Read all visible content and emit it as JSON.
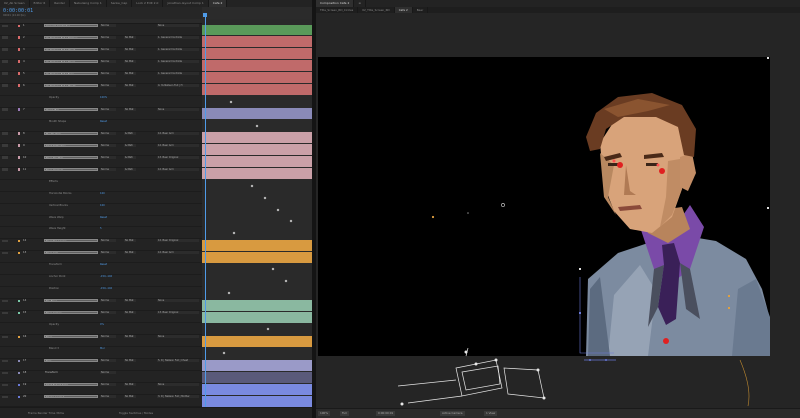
{
  "timeline": {
    "tabs": [
      {
        "label": "02_Ab Screen",
        "active": false
      },
      {
        "label": "Editor 6",
        "active": false
      },
      {
        "label": "Render",
        "active": false
      },
      {
        "label": "Nebulaing Comp 1",
        "active": false
      },
      {
        "label": "Sanke_Cap",
        "active": false
      },
      {
        "label": "Lock 2 Edit 2.0",
        "active": false
      },
      {
        "label": "Jonathan-layout Comp 1",
        "active": false
      },
      {
        "label": "Cafe 2",
        "active": true
      }
    ],
    "timecode": "0:00:00:01",
    "timecode_sub": "00001 (24.00 fps)",
    "accent": "#4f9be8",
    "layers": [
      {
        "num": "1",
        "name": "General Controller",
        "kind": "layer",
        "sel": true,
        "color": "#d86a6a",
        "mode": "Norma",
        "trk": "",
        "parent": "None",
        "bar": "#5a9a5a"
      },
      {
        "num": "2",
        "name": "Ya_Nalleon Full | Nalleon",
        "kind": "layer",
        "sel": true,
        "color": "#d86a6a",
        "mode": "Norma",
        "trk": "No Mat",
        "parent": "1. General Controlle",
        "bar": "#c06a6a"
      },
      {
        "num": "3",
        "name": "Ya_Nalleon Full | Chest",
        "kind": "layer",
        "sel": true,
        "color": "#d86a6a",
        "mode": "Norma",
        "trk": "No Mat",
        "parent": "1. General Controlle",
        "bar": "#c06a6a"
      },
      {
        "num": "4",
        "name": "Ya_Nalleon Full | Head",
        "kind": "layer",
        "sel": true,
        "color": "#d86a6a",
        "mode": "Norma",
        "trk": "No Mat",
        "parent": "1. General Controlle",
        "bar": "#c06a6a"
      },
      {
        "num": "5",
        "name": "Ya_Nalleon Full | Eyes",
        "kind": "layer",
        "sel": true,
        "color": "#d86a6a",
        "mode": "Norma",
        "trk": "No Mat",
        "parent": "1. General Controlle",
        "bar": "#c06a6a"
      },
      {
        "num": "6",
        "name": "Ya_Nalleon Full | Mouth",
        "kind": "layer",
        "sel": true,
        "color": "#d86a6a",
        "mode": "Norma",
        "trk": "No Mat",
        "parent": "4. Ya Nalleon Full | H",
        "bar": "#c06a6a"
      },
      {
        "num": "",
        "name": "Opacity",
        "kind": "prop",
        "val": "100%"
      },
      {
        "num": "7",
        "name": "Head (Bg)",
        "kind": "layer",
        "sel": true,
        "color": "#9a7ab8",
        "mode": "Norma",
        "trk": "No Mat",
        "parent": "None",
        "bar": "#8a8ab8"
      },
      {
        "num": "",
        "name": "Mouth Shape",
        "kind": "prop",
        "val": "Reset"
      },
      {
        "num": "8",
        "name": "Mouth_Plnk",
        "kind": "layer",
        "sel": true,
        "color": "#c89aa8",
        "mode": "Norma",
        "trk": "& Mati",
        "parent": "12. Beer Arm",
        "bar": "#caa0a8"
      },
      {
        "num": "9",
        "name": "Shirt Reflection",
        "kind": "layer",
        "sel": true,
        "color": "#c89aa8",
        "mode": "Norma",
        "trk": "& Mati",
        "parent": "12. Beer Arm",
        "bar": "#caa0a8"
      },
      {
        "num": "10",
        "name": "Beer Shelfish",
        "kind": "layer",
        "sel": true,
        "color": "#c89aa8",
        "mode": "Norma",
        "trk": "& Mati",
        "parent": "13. Beer Original",
        "bar": "#caa0a8"
      },
      {
        "num": "11",
        "name": "Beer Original",
        "kind": "layer",
        "sel": true,
        "color": "#c89aa8",
        "mode": "Norma",
        "trk": "& Mati",
        "parent": "12. Beer Arm",
        "bar": "#caa0a8"
      },
      {
        "num": "",
        "name": "Effects",
        "kind": "prop",
        "val": ""
      },
      {
        "num": "",
        "name": "Horizontal Blocks",
        "kind": "prop",
        "val": "100"
      },
      {
        "num": "",
        "name": "Vertical Blocks",
        "kind": "prop",
        "val": "100"
      },
      {
        "num": "",
        "name": "Wave Warp",
        "kind": "prop",
        "val": "Reset"
      },
      {
        "num": "",
        "name": "Wave Height",
        "kind": "prop",
        "val": "5"
      },
      {
        "num": "12",
        "name": "Beer Top Layers",
        "kind": "layer",
        "sel": true,
        "color": "#e0a040",
        "mode": "Norma",
        "trk": "No Mat",
        "parent": "12. Beer Original",
        "bar": "#d89a40"
      },
      {
        "num": "13",
        "name": "Beer Arm",
        "kind": "layer",
        "sel": true,
        "color": "#e0a040",
        "mode": "Norma",
        "trk": "No Mat",
        "parent": "12. Beer Arm",
        "bar": "#d89a40"
      },
      {
        "num": "",
        "name": "Transform",
        "kind": "prop",
        "val": "Reset"
      },
      {
        "num": "",
        "name": "Anchor Point",
        "kind": "prop",
        "val": "-150,-102"
      },
      {
        "num": "",
        "name": "Position",
        "kind": "prop",
        "val": "-150,-102"
      },
      {
        "num": "14",
        "name": "Bg_Beer",
        "kind": "layer",
        "sel": true,
        "color": "#7ac8a8",
        "mode": "Norma",
        "trk": "No Mat",
        "parent": "None",
        "bar": "#8ab8a0"
      },
      {
        "num": "15",
        "name": "Beer 2 Glow",
        "kind": "layer",
        "sel": true,
        "color": "#7ac8a8",
        "mode": "Norma",
        "trk": "No Mat",
        "parent": "13. Beer Original",
        "bar": "#8ab8a0"
      },
      {
        "num": "",
        "name": "Opacity",
        "kind": "prop",
        "val": "0%"
      },
      {
        "num": "16",
        "name": "Beer",
        "kind": "layer",
        "sel": true,
        "color": "#e0a040",
        "mode": "Norma",
        "trk": "No Mat",
        "parent": "None",
        "bar": "#d89a40"
      },
      {
        "num": "",
        "name": "Blend 3",
        "kind": "prop",
        "val": "Mul"
      },
      {
        "num": "17",
        "name": "Bsle",
        "kind": "layer",
        "sel": true,
        "color": "#8a8ab8",
        "mode": "Norma",
        "trk": "No Mat",
        "parent": "5. R | Nalleon Full | Chest",
        "bar": "#9a9ac8"
      },
      {
        "num": "18",
        "name": "Transform",
        "kind": "layer",
        "sel": false,
        "color": "#8a8ab8",
        "mode": "Norma",
        "trk": "",
        "parent": "",
        "bar": "#5a5a7a"
      },
      {
        "num": "19",
        "name": "Shirt Full at Arms",
        "kind": "layer",
        "sel": true,
        "color": "#6a7ad8",
        "mode": "Norma",
        "trk": "No Mat",
        "parent": "None",
        "bar": "#7a8ae0"
      },
      {
        "num": "20",
        "name": "Shape Layer 1",
        "kind": "layer",
        "sel": true,
        "color": "#6a7ad8",
        "mode": "Norma",
        "trk": "No Mat",
        "parent": "3. R | Nalleon Full | Mother",
        "bar": "#7a8ae0"
      }
    ],
    "footer": {
      "render_time": "Frame Render Time 36ms",
      "toggle": "Toggle Switches / Modes"
    }
  },
  "composition": {
    "tabs": [
      {
        "label": "Composition Cafe 2",
        "active": true
      },
      {
        "label": "≡",
        "active": false
      }
    ],
    "breadcrumbs": [
      "Title_Screen_RD_Circles",
      "02_Title_Screen_RD",
      "Cafe 2",
      "Beer"
    ],
    "footer": {
      "zoom": "100%",
      "res": "Full",
      "time": "0:00:00:01",
      "view": "Active Camera",
      "views": "1 View"
    }
  }
}
